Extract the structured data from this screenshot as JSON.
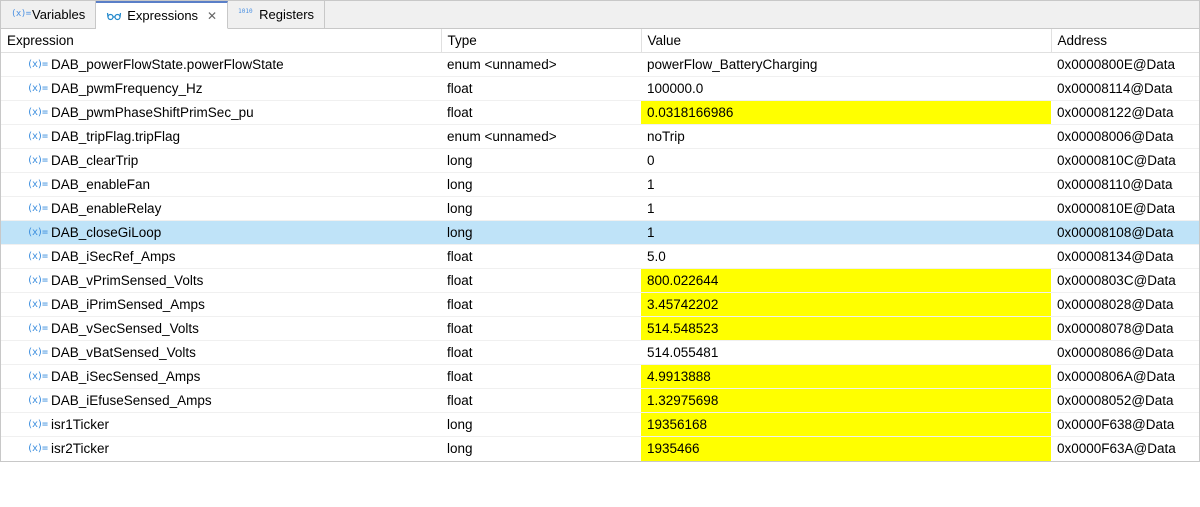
{
  "tabs": [
    {
      "label": "Variables",
      "icon": "var",
      "active": false,
      "closable": false
    },
    {
      "label": "Expressions",
      "icon": "expr",
      "active": true,
      "closable": true
    },
    {
      "label": "Registers",
      "icon": "reg",
      "active": false,
      "closable": false
    }
  ],
  "columns": {
    "expression": "Expression",
    "type": "Type",
    "value": "Value",
    "address": "Address"
  },
  "rows": [
    {
      "name": "DAB_powerFlowState.powerFlowState",
      "type": "enum <unnamed>",
      "value": "powerFlow_BatteryCharging",
      "address": "0x0000800E@Data",
      "highlighted": false,
      "selected": false
    },
    {
      "name": "DAB_pwmFrequency_Hz",
      "type": "float",
      "value": "100000.0",
      "address": "0x00008114@Data",
      "highlighted": false,
      "selected": false
    },
    {
      "name": "DAB_pwmPhaseShiftPrimSec_pu",
      "type": "float",
      "value": "0.0318166986",
      "address": "0x00008122@Data",
      "highlighted": true,
      "selected": false
    },
    {
      "name": "DAB_tripFlag.tripFlag",
      "type": "enum <unnamed>",
      "value": "noTrip",
      "address": "0x00008006@Data",
      "highlighted": false,
      "selected": false
    },
    {
      "name": "DAB_clearTrip",
      "type": "long",
      "value": "0",
      "address": "0x0000810C@Data",
      "highlighted": false,
      "selected": false
    },
    {
      "name": "DAB_enableFan",
      "type": "long",
      "value": "1",
      "address": "0x00008110@Data",
      "highlighted": false,
      "selected": false
    },
    {
      "name": "DAB_enableRelay",
      "type": "long",
      "value": "1",
      "address": "0x0000810E@Data",
      "highlighted": false,
      "selected": false
    },
    {
      "name": "DAB_closeGiLoop",
      "type": "long",
      "value": "1",
      "address": "0x00008108@Data",
      "highlighted": false,
      "selected": true
    },
    {
      "name": "DAB_iSecRef_Amps",
      "type": "float",
      "value": "5.0",
      "address": "0x00008134@Data",
      "highlighted": false,
      "selected": false
    },
    {
      "name": "DAB_vPrimSensed_Volts",
      "type": "float",
      "value": "800.022644",
      "address": "0x0000803C@Data",
      "highlighted": true,
      "selected": false
    },
    {
      "name": "DAB_iPrimSensed_Amps",
      "type": "float",
      "value": "3.45742202",
      "address": "0x00008028@Data",
      "highlighted": true,
      "selected": false
    },
    {
      "name": "DAB_vSecSensed_Volts",
      "type": "float",
      "value": "514.548523",
      "address": "0x00008078@Data",
      "highlighted": true,
      "selected": false
    },
    {
      "name": "DAB_vBatSensed_Volts",
      "type": "float",
      "value": "514.055481",
      "address": "0x00008086@Data",
      "highlighted": false,
      "selected": false
    },
    {
      "name": "DAB_iSecSensed_Amps",
      "type": "float",
      "value": "4.9913888",
      "address": "0x0000806A@Data",
      "highlighted": true,
      "selected": false
    },
    {
      "name": "DAB_iEfuseSensed_Amps",
      "type": "float",
      "value": "1.32975698",
      "address": "0x00008052@Data",
      "highlighted": true,
      "selected": false
    },
    {
      "name": "isr1Ticker",
      "type": "long",
      "value": "19356168",
      "address": "0x0000F638@Data",
      "highlighted": true,
      "selected": false
    },
    {
      "name": "isr2Ticker",
      "type": "long",
      "value": "1935466",
      "address": "0x0000F63A@Data",
      "highlighted": true,
      "selected": false
    }
  ]
}
